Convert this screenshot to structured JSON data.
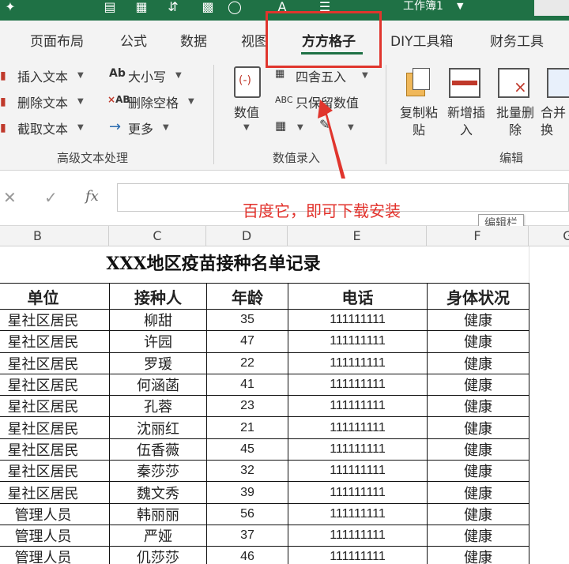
{
  "titlebar": {
    "workbook_name": "工作簿1",
    "icons": [
      "paint-brush-icon",
      "clipboard-icon",
      "sort-icon",
      "chart-icon",
      "shapes-icon",
      "text-format-icon",
      "customize-icon"
    ]
  },
  "tabs": [
    {
      "label": "页面布局"
    },
    {
      "label": "公式"
    },
    {
      "label": "数据"
    },
    {
      "label": "视图"
    },
    {
      "label": "方方格子",
      "active": true
    },
    {
      "label": "DIY工具箱"
    },
    {
      "label": "财务工具"
    }
  ],
  "ribbon": {
    "text_group": {
      "items": [
        "插入文本",
        "删除文本",
        "截取文本",
        "大小写",
        "删除空格",
        "更多"
      ],
      "label": "高级文本处理"
    },
    "value_group": {
      "big_button": "数值",
      "items": [
        "四舍五入",
        "只保留数值"
      ],
      "label": "数值录入"
    },
    "edit_group": {
      "buttons": [
        "复制粘贴",
        "新增插入",
        "批量删除",
        "合并转换"
      ],
      "label": "编辑",
      "lines": [
        [
          "复制粘",
          "贴"
        ],
        [
          "新增插",
          "入"
        ],
        [
          "批量删",
          "除"
        ],
        [
          "合并",
          "换"
        ]
      ]
    }
  },
  "formula_bar": {
    "name_box": "",
    "value": ""
  },
  "annotation_text": "百度它，即可下载安装",
  "tooltip_text": "编辑栏",
  "columns": [
    "B",
    "C",
    "D",
    "E",
    "F",
    "G"
  ],
  "sheet": {
    "title": "XXX地区疫苗接种名单记录",
    "headers": [
      "单位",
      "接种人",
      "年龄",
      "电话",
      "身体状况"
    ],
    "rows": [
      [
        "星社区居民",
        "柳甜",
        "35",
        "111111111",
        "健康"
      ],
      [
        "星社区居民",
        "许园",
        "47",
        "111111111",
        "健康"
      ],
      [
        "星社区居民",
        "罗瑗",
        "22",
        "111111111",
        "健康"
      ],
      [
        "星社区居民",
        "何涵菡",
        "41",
        "111111111",
        "健康"
      ],
      [
        "星社区居民",
        "孔蓉",
        "23",
        "111111111",
        "健康"
      ],
      [
        "星社区居民",
        "沈丽红",
        "21",
        "111111111",
        "健康"
      ],
      [
        "星社区居民",
        "伍香薇",
        "45",
        "111111111",
        "健康"
      ],
      [
        "星社区居民",
        "秦莎莎",
        "32",
        "111111111",
        "健康"
      ],
      [
        "星社区居民",
        "魏文秀",
        "39",
        "111111111",
        "健康"
      ],
      [
        "管理人员",
        "韩丽丽",
        "56",
        "111111111",
        "健康"
      ],
      [
        "管理人员",
        "严娅",
        "37",
        "111111111",
        "健康"
      ],
      [
        "管理人员",
        "仉莎莎",
        "46",
        "111111111",
        "健康"
      ]
    ]
  },
  "colors": {
    "accent": "#1f7145",
    "highlight": "#e0352d",
    "annotation": "#e2312b"
  }
}
